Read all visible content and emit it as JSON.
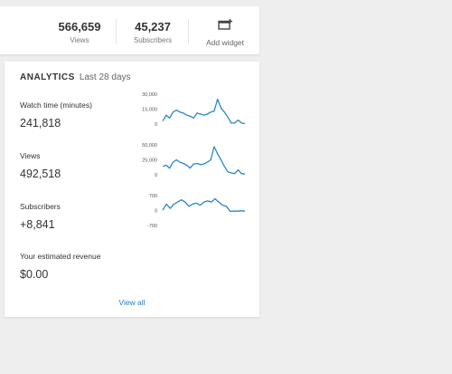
{
  "stats": {
    "views": {
      "value": "566,659",
      "label": "Views"
    },
    "subscribers": {
      "value": "45,237",
      "label": "Subscribers"
    },
    "add_widget": {
      "label": "Add widget",
      "icon": "add-widget-icon"
    }
  },
  "analytics": {
    "title": "ANALYTICS",
    "period": "Last 28 days",
    "accent_color": "#2a87c0",
    "link_color": "#2a7cc7",
    "view_all": "View all",
    "metrics": [
      {
        "label": "Watch time (minutes)",
        "value": "241,818",
        "ticks": [
          "30,000",
          "15,000",
          "0"
        ],
        "range": [
          0,
          30000
        ],
        "series": [
          3000,
          9000,
          6000,
          12000,
          14000,
          12000,
          11000,
          9000,
          8000,
          6000,
          11000,
          10000,
          9000,
          10000,
          12000,
          13000,
          25000,
          16000,
          12000,
          7000,
          1000,
          1000,
          4000,
          1000,
          500
        ]
      },
      {
        "label": "Views",
        "value": "492,518",
        "ticks": [
          "50,000",
          "25,000",
          "0"
        ],
        "range": [
          0,
          50000
        ],
        "series": [
          14000,
          16000,
          11000,
          21000,
          25000,
          21000,
          19000,
          16000,
          11000,
          18000,
          19000,
          17000,
          18000,
          21000,
          25000,
          47000,
          35000,
          25000,
          14000,
          5000,
          3000,
          2000,
          8000,
          2000,
          1000
        ]
      },
      {
        "label": "Subscribers",
        "value": "+8,841",
        "ticks": [
          "700",
          "0",
          "-700"
        ],
        "range": [
          -700,
          700
        ],
        "series": [
          20,
          300,
          100,
          300,
          400,
          500,
          400,
          200,
          300,
          350,
          250,
          400,
          450,
          400,
          550,
          400,
          250,
          200,
          -30,
          -30,
          -30,
          -10,
          -30
        ]
      },
      {
        "label": "Your estimated revenue",
        "value": "$0.00"
      }
    ]
  }
}
